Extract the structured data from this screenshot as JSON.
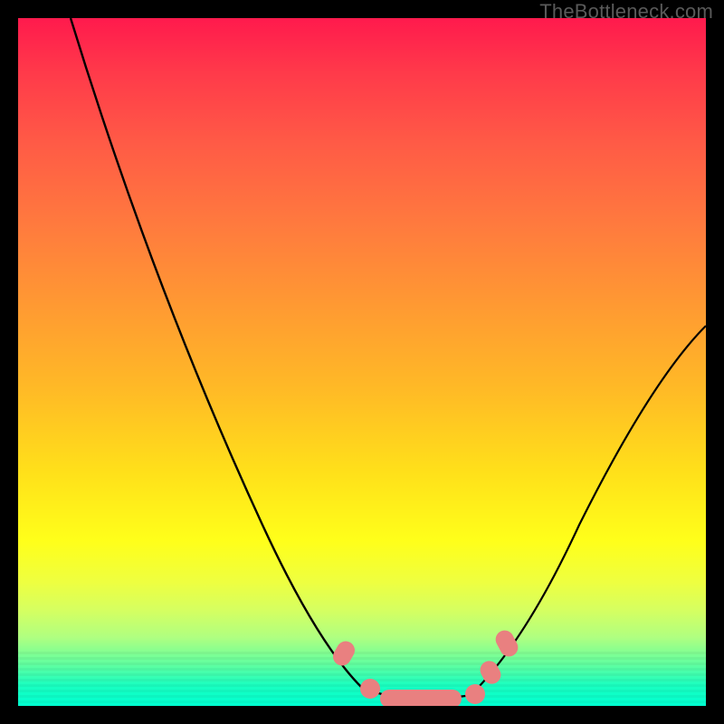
{
  "watermark": {
    "text": "TheBottleneck.com"
  },
  "chart_data": {
    "type": "line",
    "title": "",
    "xlabel": "",
    "ylabel": "",
    "xlim": [
      0,
      100
    ],
    "ylim": [
      0,
      100
    ],
    "grid": false,
    "legend": false,
    "background": {
      "gradient_top_color": "#ff1a4d",
      "gradient_bottom_color": "#00ffd0"
    },
    "series": [
      {
        "name": "bottleneck-curve",
        "color": "#000000",
        "x": [
          0,
          6,
          12,
          18,
          24,
          30,
          36,
          42,
          48,
          52,
          56,
          60,
          66,
          72,
          78,
          84,
          90,
          96,
          100
        ],
        "y": [
          100,
          92,
          83,
          73,
          62,
          51,
          39,
          27,
          13,
          5,
          0,
          0,
          0,
          6,
          16,
          27,
          37,
          45,
          50
        ]
      }
    ],
    "markers": [
      {
        "name": "range-markers",
        "color": "#e98080",
        "shape": "rounded-rect",
        "points": [
          {
            "x": 48,
            "y": 8
          },
          {
            "x": 52,
            "y": 1
          },
          {
            "x": 56,
            "y": 0
          },
          {
            "x": 60,
            "y": 0
          },
          {
            "x": 64,
            "y": 0
          },
          {
            "x": 68,
            "y": 0
          },
          {
            "x": 71,
            "y": 3
          },
          {
            "x": 73,
            "y": 10
          }
        ]
      }
    ]
  }
}
